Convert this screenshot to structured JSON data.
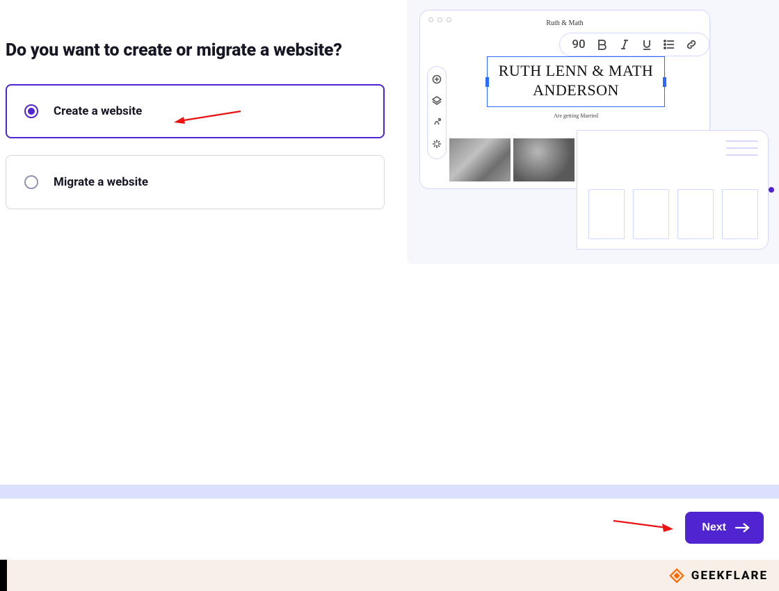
{
  "heading": "Do you want to create or migrate a website?",
  "options": [
    {
      "label": "Create a website",
      "selected": true
    },
    {
      "label": "Migrate a website",
      "selected": false
    }
  ],
  "toolbar": {
    "font_size": "90"
  },
  "preview": {
    "site_title": "Ruth & Math",
    "headline_line1": "RUTH LENN & MATH",
    "headline_line2": "ANDERSON",
    "subhead": "Are getting Married"
  },
  "footer": {
    "next_label": "Next"
  },
  "watermark": {
    "brand": "GEEKFLARE"
  }
}
